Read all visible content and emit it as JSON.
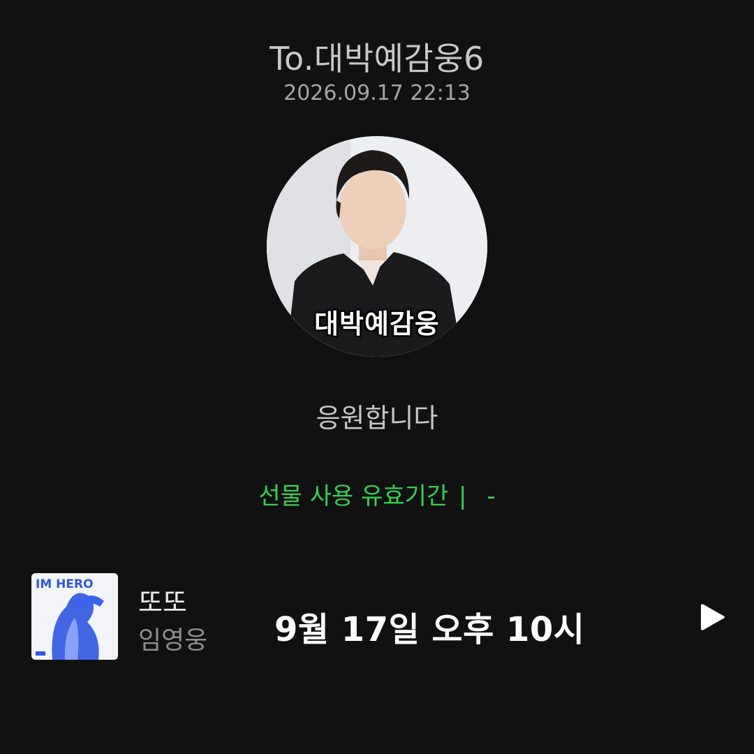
{
  "header": {
    "recipient": "To.대박예감웅6",
    "timestamp": "2026.09.17 22:13"
  },
  "profile": {
    "image_caption": "대박예감웅"
  },
  "message": {
    "text": "응원합니다"
  },
  "gift": {
    "validity_label": "선물 사용 유효기간",
    "separator": "|",
    "validity_value": "-"
  },
  "player": {
    "album_art_text": "IM HERO",
    "song_title": "또또",
    "artist": "임영웅",
    "overlay_text": "9월 17일 오후 10시",
    "play_icon": "play-icon"
  },
  "colors": {
    "background": "#111111",
    "accent_green": "#35d052",
    "album_blue": "#2f56e0"
  }
}
